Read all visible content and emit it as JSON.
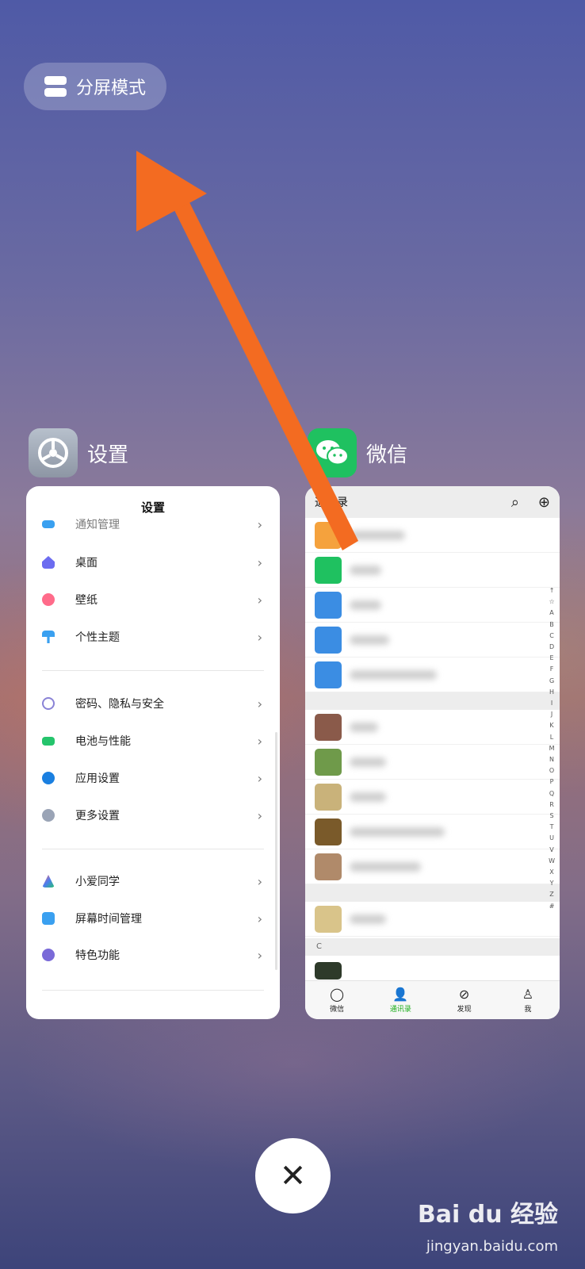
{
  "split_mode": {
    "label": "分屏模式"
  },
  "settings_app": {
    "name": "设置",
    "title": "设置",
    "items_top": [
      {
        "label": "通知管理",
        "icon": "bell-icon",
        "color": "#3aa0f0"
      },
      {
        "label": "桌面",
        "icon": "home-icon",
        "color": "#6c6cf0"
      },
      {
        "label": "壁纸",
        "icon": "flower-icon",
        "color": "#ff6b8a"
      },
      {
        "label": "个性主题",
        "icon": "brush-icon",
        "color": "#3aa0f0"
      }
    ],
    "items_mid": [
      {
        "label": "密码、隐私与安全",
        "icon": "fingerprint-icon",
        "color": "#8a83d6"
      },
      {
        "label": "电池与性能",
        "icon": "battery-icon",
        "color": "#25c46c"
      },
      {
        "label": "应用设置",
        "icon": "gear-icon",
        "color": "#1a7fe0"
      },
      {
        "label": "更多设置",
        "icon": "more-icon",
        "color": "#9aa4b6"
      }
    ],
    "items_bottom": [
      {
        "label": "小爱同学",
        "icon": "xiaoai-icon",
        "color": "#4e7cf0"
      },
      {
        "label": "屏幕时间管理",
        "icon": "hourglass-icon",
        "color": "#3aa0f0"
      },
      {
        "label": "特色功能",
        "icon": "feature-icon",
        "color": "#7a6ad8"
      }
    ]
  },
  "wechat_app": {
    "name": "微信",
    "title": "通讯录",
    "section_c": "C",
    "index": [
      "↑",
      "☆",
      "A",
      "B",
      "C",
      "D",
      "E",
      "F",
      "G",
      "H",
      "I",
      "J",
      "K",
      "L",
      "M",
      "N",
      "O",
      "P",
      "Q",
      "R",
      "S",
      "T",
      "U",
      "V",
      "W",
      "X",
      "Y",
      "Z",
      "#"
    ],
    "tabs": [
      {
        "label": "微信",
        "icon": "chat-icon"
      },
      {
        "label": "通讯录",
        "icon": "contacts-icon"
      },
      {
        "label": "发现",
        "icon": "compass-icon"
      },
      {
        "label": "我",
        "icon": "person-icon"
      }
    ]
  },
  "watermark": {
    "brand": "Bai du 经验",
    "url": "jingyan.baidu.com"
  },
  "colors": {
    "wechat_green": "#1fc160",
    "arrow": "#f36b21"
  }
}
